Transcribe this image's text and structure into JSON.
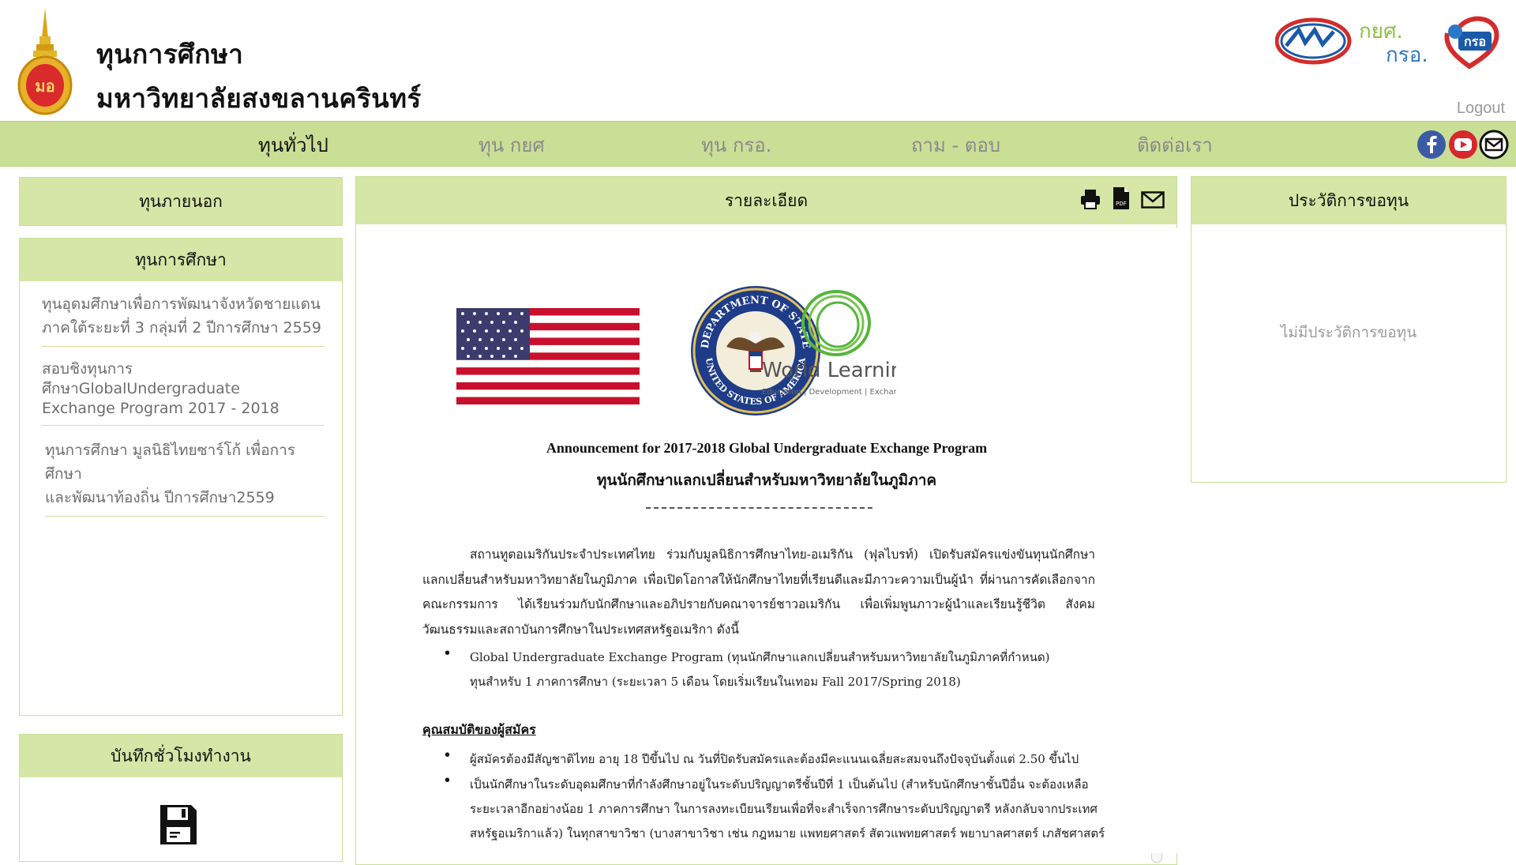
{
  "header": {
    "title_line1": "ทุนการศึกษา",
    "title_line2": "มหาวิทยาลัยสงขลานครินทร์",
    "logout": "Logout",
    "partner_text_1": "กยศ.",
    "partner_text_2": "กรอ.",
    "partner_badge": "กรอ"
  },
  "nav": {
    "items": [
      {
        "label": "ทุนทั่วไป",
        "active": true
      },
      {
        "label": "ทุน กยศ",
        "active": false
      },
      {
        "label": "ทุน กรอ.",
        "active": false
      },
      {
        "label": "ถาม - ตอบ",
        "active": false
      },
      {
        "label": "ติดต่อเรา",
        "active": false
      }
    ],
    "social_icons": [
      "facebook-icon",
      "youtube-icon",
      "line-icon"
    ]
  },
  "left": {
    "external_header": "ทุนภายนอก",
    "scholarship_header": "ทุนการศึกษา",
    "items": [
      {
        "line1": "ทุนอุดมศึกษาเพื่อการพัฒนาจังหวัดชายแดน",
        "line2": "ภาคใต้ระยะที่ 3 กลุ่มที่ 2 ปีการศึกษา 2559"
      },
      {
        "line1": "สอบชิงทุนการศึกษาGlobalUndergraduate",
        "line2": "Exchange Program 2017 - 2018"
      },
      {
        "line1": "ทุนการศึกษา มูลนิธิไทยซาร์โก้ เพื่อการศึกษา",
        "line2": "และพัฒนาท้องถิ่น ปีการศึกษา2559"
      }
    ],
    "work_hours_header": "บันทึกชั่วโมงทำงาน"
  },
  "center": {
    "header": "รายละเอียด",
    "toolbar_icons": [
      "print-icon",
      "pdf-icon",
      "mail-icon"
    ],
    "doc": {
      "world_learning_name": "World Learning",
      "world_learning_tagline": "Education | Development | Exchange",
      "seal_text_top": "DEPARTMENT OF STATE",
      "seal_text_bottom": "UNITED STATES OF AMERICA",
      "title_en": "Announcement for 2017-2018 Global Undergraduate Exchange Program",
      "title_th": "ทุนนักศึกษาแลกเปลี่ยนสำหรับมหาวิทยาลัยในภูมิภาค",
      "paragraph": "สถานทูตอเมริกันประจำประเทศไทย ร่วมกับมูลนิธิการศึกษาไทย-อเมริกัน (ฟุลไบรท์) เปิดรับสมัครแข่งขันทุนนักศึกษาแลกเปลี่ยนสำหรับมหาวิทยาลัยในภูมิภาค เพื่อเปิดโอกาสให้นักศึกษาไทยที่เรียนดีและมีภาวะความเป็นผู้นำ ที่ผ่านการคัดเลือกจากคณะกรรมการ ได้เรียนร่วมกับนักศึกษาและอภิปรายกับคณาจารย์ชาวอเมริกัน เพื่อเพิ่มพูนภาวะผู้นำและเรียนรู้ชีวิต สังคม วัฒนธรรมและสถาบันการศึกษาในประเทศสหรัฐอเมริกา ดังนี้",
      "bullet1": "Global Undergraduate Exchange Program (ทุนนักศึกษาแลกเปลี่ยนสำหรับมหาวิทยาลัยในภูมิภาคที่กำหนด)",
      "bullet1_sub": "ทุนสำหรับ 1 ภาคการศึกษา (ระยะเวลา 5 เดือน โดยเริ่มเรียนในเทอม Fall 2017/Spring 2018)",
      "qualifications_heading": "คุณสมบัติของผู้สมัคร",
      "qual1": "ผู้สมัครต้องมีสัญชาติไทย อายุ 18 ปีขึ้นไป ณ วันที่ปิดรับสมัครและต้องมีคะแนนเฉลี่ยสะสมจนถึงปัจจุบันตั้งแต่ 2.50 ขึ้นไป",
      "qual2_l1": "เป็นนักศึกษาในระดับอุดมศึกษาที่กำลังศึกษาอยู่ในระดับปริญญาตรีชั้นปีที่ 1 เป็นต้นไป (สำหรับนักศึกษาชั้นปีอื่น จะต้องเหลือ",
      "qual2_l2": "ระยะเวลาอีกอย่างน้อย 1 ภาคการศึกษา ในการลงทะเบียนเรียนเพื่อที่จะสำเร็จการศึกษาระดับปริญญาตรี หลังกลับจากประเทศ",
      "qual2_l3": "สหรัฐอเมริกาแล้ว) ในทุกสาขาวิชา (บางสาขาวิชา เช่น กฎหมาย แพทยศาสตร์ สัตวแพทยศาสตร์ พยาบาลศาสตร์ เภสัชศาสตร์"
    }
  },
  "right": {
    "header": "ประวัติการขอทุน",
    "empty_text": "ไม่มีประวัติการขอทุน"
  },
  "colors": {
    "nav_bg": "#c9df96",
    "panel_head_bg": "#d5e6a6",
    "panel_border": "#c9df96"
  }
}
